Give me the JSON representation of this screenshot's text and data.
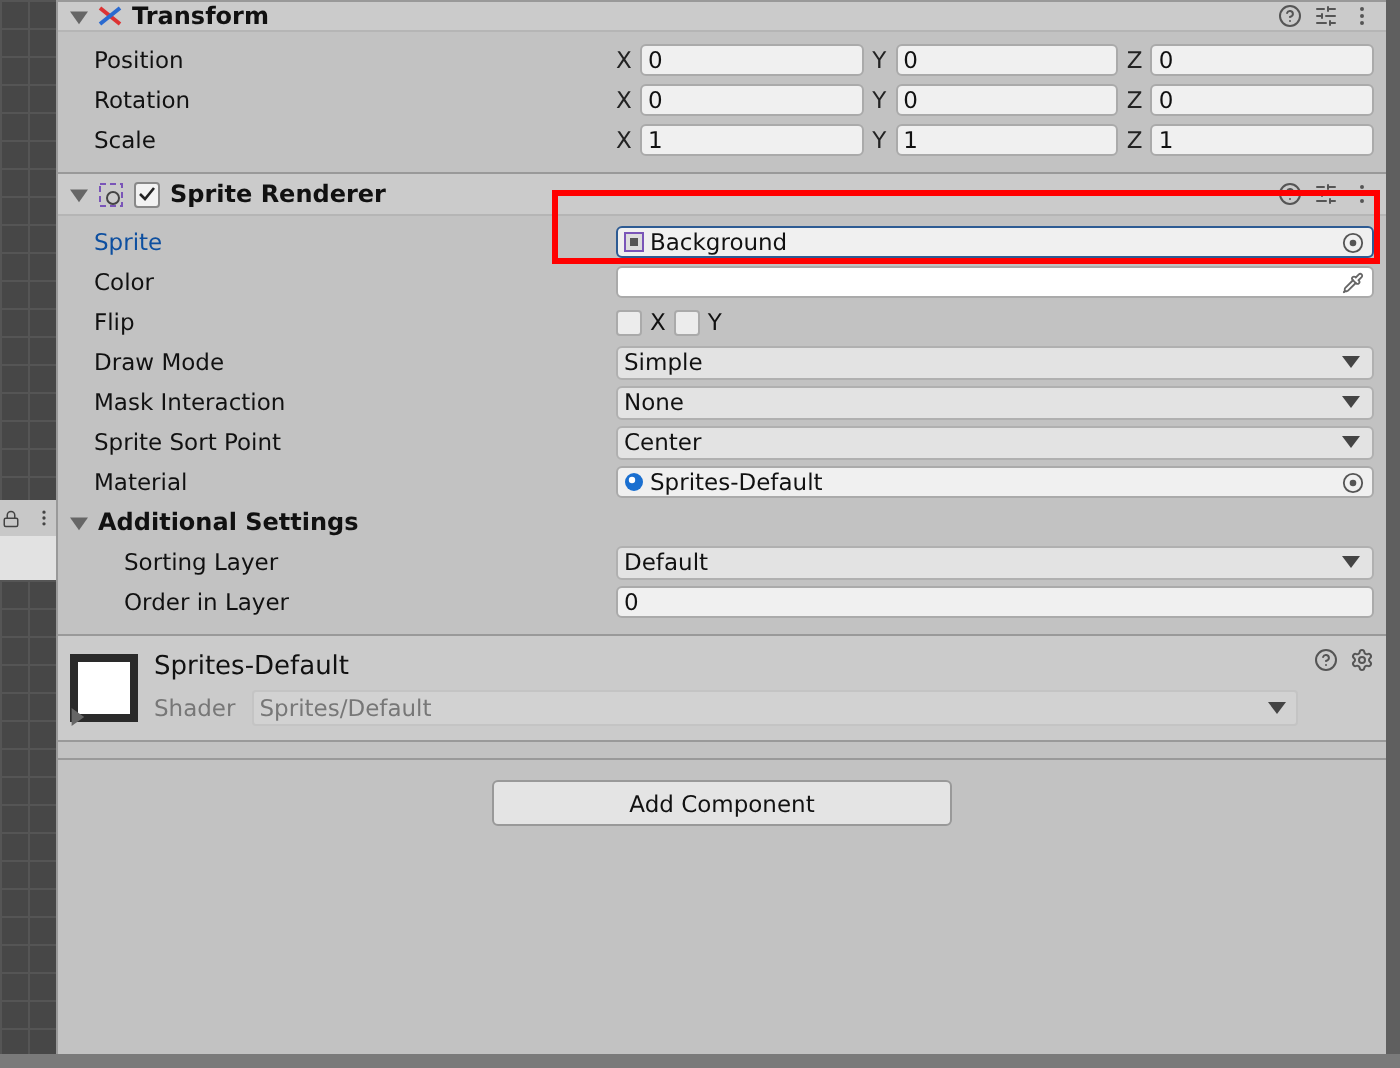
{
  "transform": {
    "title": "Transform",
    "expanded": true,
    "rows": [
      {
        "label": "Position",
        "fields": [
          {
            "axis": "X",
            "value": "0"
          },
          {
            "axis": "Y",
            "value": "0"
          },
          {
            "axis": "Z",
            "value": "0"
          }
        ]
      },
      {
        "label": "Rotation",
        "fields": [
          {
            "axis": "X",
            "value": "0"
          },
          {
            "axis": "Y",
            "value": "0"
          },
          {
            "axis": "Z",
            "value": "0"
          }
        ]
      },
      {
        "label": "Scale",
        "fields": [
          {
            "axis": "X",
            "value": "1"
          },
          {
            "axis": "Y",
            "value": "1"
          },
          {
            "axis": "Z",
            "value": "1"
          }
        ]
      }
    ]
  },
  "sprite_renderer": {
    "title": "Sprite Renderer",
    "enabled": true,
    "expanded": true,
    "properties": [
      {
        "kind": "sprite_ref",
        "label": "Sprite",
        "value": "Background",
        "focused": true
      },
      {
        "kind": "color",
        "label": "Color",
        "focused": false
      },
      {
        "kind": "flip",
        "label": "Flip",
        "focused": false,
        "options": [
          {
            "label": "X",
            "checked": false
          },
          {
            "label": "Y",
            "checked": false
          }
        ]
      },
      {
        "kind": "dropdown",
        "label": "Draw Mode",
        "value": "Simple",
        "focused": false
      },
      {
        "kind": "dropdown",
        "label": "Mask Interaction",
        "value": "None",
        "focused": false
      },
      {
        "kind": "dropdown",
        "label": "Sprite Sort Point",
        "value": "Center",
        "focused": false
      },
      {
        "kind": "material_ref",
        "label": "Material",
        "value": "Sprites-Default",
        "focused": false
      }
    ],
    "additional_settings": {
      "title": "Additional Settings",
      "expanded": true,
      "properties": [
        {
          "kind": "dropdown",
          "label": "Sorting Layer",
          "value": "Default",
          "focused": false
        },
        {
          "kind": "text",
          "label": "Order in Layer",
          "value": "0",
          "focused": false
        }
      ]
    }
  },
  "material": {
    "name": "Sprites-Default",
    "expanded": false,
    "shader_label": "Shader",
    "shader": "Sprites/Default"
  },
  "add_component_button": "Add Component"
}
